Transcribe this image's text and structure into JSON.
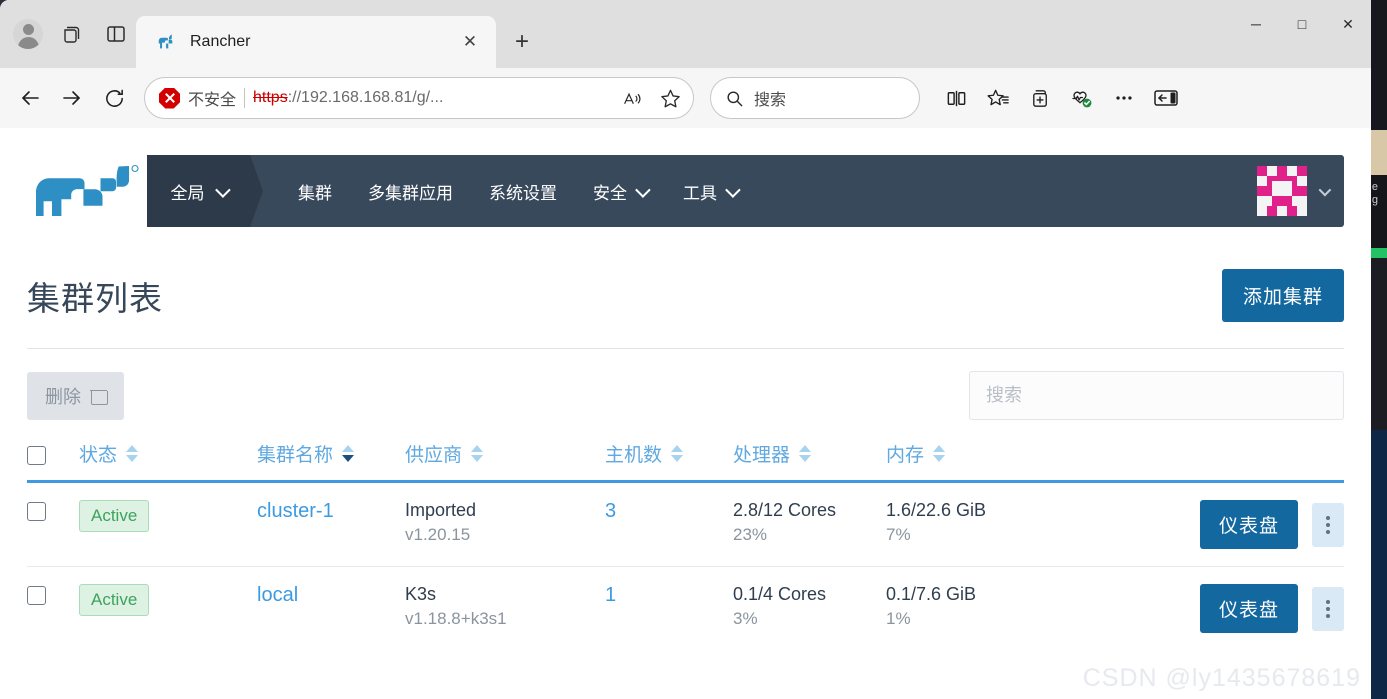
{
  "browser": {
    "profile_icon": "account-avatar-icon",
    "workspaces_icon": "workspaces-icon",
    "tab_actions_icon": "tab-actions-icon",
    "tab": {
      "title": "Rancher",
      "favicon": "rancher-cow-favicon",
      "close_label": "✕"
    },
    "new_tab_label": "+",
    "window_controls": {
      "minimize": "─",
      "maximize": "□",
      "close": "✕"
    },
    "nav": {
      "back": "←",
      "forward": "→",
      "reload": "↻"
    },
    "url": {
      "security_label": "不安全",
      "scheme": "https",
      "rest": "://192.168.168.81/g/...",
      "read_aloud_icon": "read-aloud-icon",
      "favorite_icon": "star-icon"
    },
    "search": {
      "placeholder": "搜索",
      "icon": "search-icon"
    },
    "toolbar_icons": [
      {
        "name": "split-screen-icon"
      },
      {
        "name": "favorites-icon"
      },
      {
        "name": "collections-icon"
      },
      {
        "name": "browser-essentials-icon"
      },
      {
        "name": "settings-more-icon"
      },
      {
        "name": "sidebar-toggle-icon"
      }
    ]
  },
  "rancher": {
    "logo_name": "rancher-logo",
    "nav": {
      "global_label": "全局",
      "items": [
        {
          "label": "集群",
          "has_chevron": false
        },
        {
          "label": "多集群应用",
          "has_chevron": false
        },
        {
          "label": "系统设置",
          "has_chevron": false
        },
        {
          "label": "安全",
          "has_chevron": true
        },
        {
          "label": "工具",
          "has_chevron": true
        }
      ],
      "avatar_name": "user-identicon-avatar"
    },
    "page_title": "集群列表",
    "add_cluster_label": "添加集群",
    "delete_label": "删除",
    "table_search_placeholder": "搜索",
    "table": {
      "columns": [
        {
          "key": "checkbox",
          "label": "",
          "sortable": false
        },
        {
          "key": "state",
          "label": "状态",
          "sortable": true,
          "active": false
        },
        {
          "key": "name",
          "label": "集群名称",
          "sortable": true,
          "active": true
        },
        {
          "key": "provider",
          "label": "供应商",
          "sortable": true,
          "active": false
        },
        {
          "key": "nodes",
          "label": "主机数",
          "sortable": true,
          "active": false
        },
        {
          "key": "cpu",
          "label": "处理器",
          "sortable": true,
          "active": false
        },
        {
          "key": "memory",
          "label": "内存",
          "sortable": true,
          "active": false
        },
        {
          "key": "actions",
          "label": "",
          "sortable": false
        }
      ],
      "rows": [
        {
          "selected": false,
          "state": "Active",
          "name": "cluster-1",
          "provider": "Imported",
          "provider_version": "v1.20.15",
          "nodes": "3",
          "cpu": "2.8/12 Cores",
          "cpu_percent": "23%",
          "memory": "1.6/22.6 GiB",
          "memory_percent": "7%",
          "dashboard_label": "仪表盘"
        },
        {
          "selected": false,
          "state": "Active",
          "name": "local",
          "provider": "K3s",
          "provider_version": "v1.18.8+k3s1",
          "nodes": "1",
          "cpu": "0.1/4 Cores",
          "cpu_percent": "3%",
          "memory": "0.1/7.6 GiB",
          "memory_percent": "1%",
          "dashboard_label": "仪表盘"
        }
      ]
    }
  },
  "watermark": "CSDN @ly1435678619",
  "colors": {
    "nav_bg": "#38495c",
    "nav_global_bg": "#2c3a49",
    "primary_blue": "#1468a0",
    "link_blue": "#3d9ae0",
    "header_blue": "#5fa8e0",
    "active_badge_bg": "#ddf2e2",
    "active_badge_text": "#3da35d",
    "title_color": "#37475a",
    "avatar_pink": "#e0218a"
  }
}
